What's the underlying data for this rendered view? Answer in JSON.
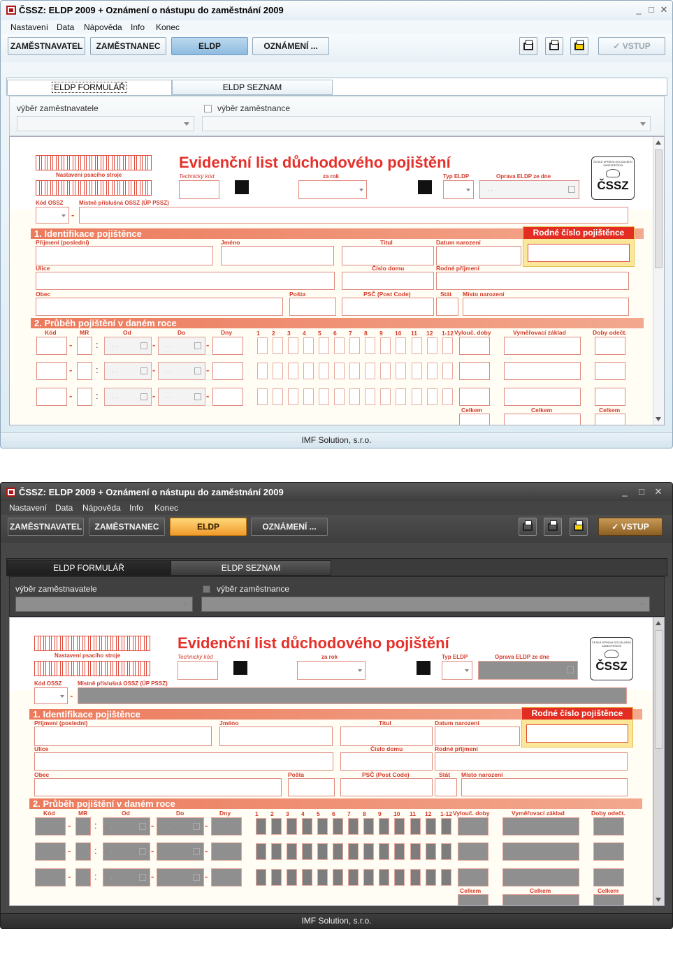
{
  "window": {
    "title": "ČSSZ: ELDP 2009 + Oznámení o nástupu do zaměstnání 2009",
    "controls": [
      "_",
      "□",
      "✕"
    ]
  },
  "menu": [
    "Nastavení",
    "Data",
    "Nápověda",
    "Info",
    "Konec"
  ],
  "toolbar": {
    "buttons": [
      "ZAMĚSTNAVATEL",
      "ZAMĚSTNANEC",
      "ELDP",
      "OZNÁMENÍ ..."
    ],
    "active": "ELDP",
    "print_icons": [
      "printer-icon",
      "printer-list-icon",
      "printer-yellow-icon"
    ],
    "vstup": "VSTUP"
  },
  "tabs": [
    "ELDP FORMULÁŘ",
    "ELDP SEZNAM"
  ],
  "selectors": {
    "employer_label": "výběr zaměstnavatele",
    "employee_label": "výběr zaměstnance"
  },
  "form": {
    "title": "Evidenční list důchodového pojištění",
    "barcode_label": "Nastavení psacího stroje",
    "technicky_kod": "Technický kód",
    "za_rok": "za rok",
    "typ_eldp": "Typ ELDP",
    "oprava": "Oprava ELDP ze dne",
    "kod_ossz": "Kód OSSZ",
    "mistne": "Místně příslušná OSSZ (ÚP PSSZ)",
    "logo_small": "ČESKÁ SPRÁVA SOCIÁLNÍHO ZABEZPEČENÍ",
    "logo": "ČSSZ",
    "section1": "1. Identifikace pojištěnce",
    "rodne_cislo": "Rodné číslo pojištěnce",
    "labels1": {
      "prijmeni": "Příjmení (poslední)",
      "jmeno": "Jméno",
      "titul": "Titul",
      "datum": "Datum narození",
      "ulice": "Ulice",
      "cislo_domu": "Číslo domu",
      "rodne_prijmeni": "Rodné příjmení",
      "obec": "Obec",
      "posta": "Pošta",
      "psc": "PSČ (Post Code)",
      "stat": "Stát",
      "misto": "Místo narození"
    },
    "section2": "2. Průběh pojištění v daném roce",
    "labels2": {
      "kod": "Kód",
      "mr": "MR",
      "od": "Od",
      "do": "Do",
      "dny": "Dny",
      "months": [
        "1",
        "2",
        "3",
        "4",
        "5",
        "6",
        "7",
        "8",
        "9",
        "10",
        "11",
        "12",
        "1-12"
      ],
      "vylouc": "Vylouč. doby",
      "vymer": "Vyměřovací základ",
      "doby": "Doby odečt.",
      "celkem": "Celkem"
    },
    "date_placeholder": ". ."
  },
  "status": "IMF Solution, s.r.o.",
  "themes": {
    "light": {
      "accent": "#8ebbe0"
    },
    "dark": {
      "accent": "#f19a2b"
    }
  }
}
